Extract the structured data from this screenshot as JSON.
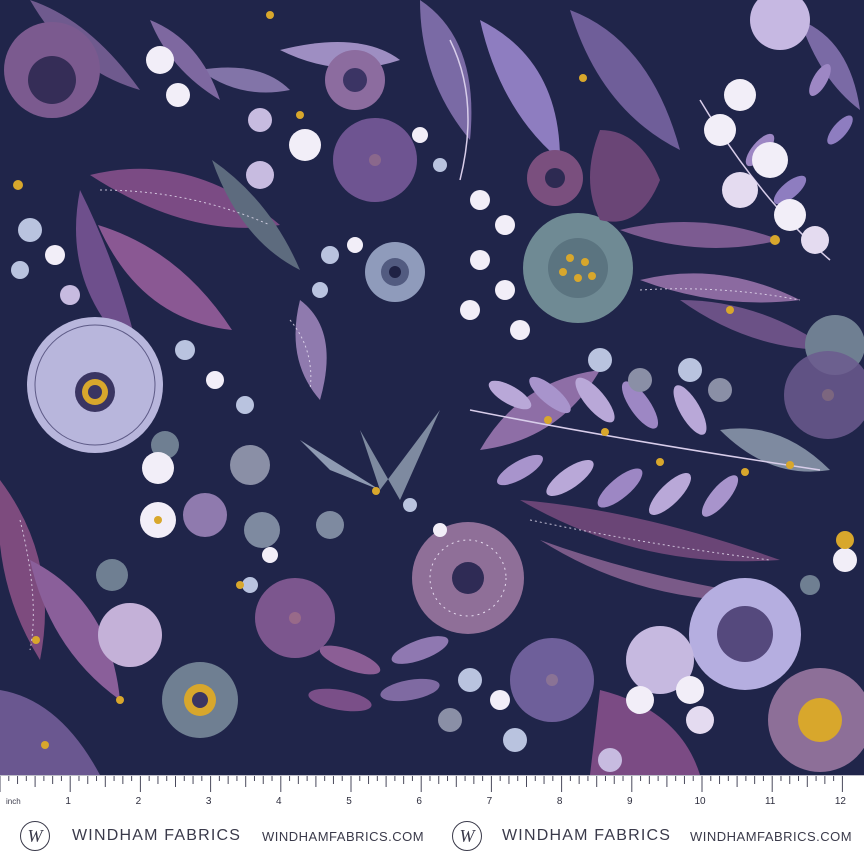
{
  "ruler": {
    "unit": "inch",
    "numbers": [
      "1",
      "2",
      "3",
      "4",
      "5",
      "6",
      "7",
      "8",
      "9",
      "10",
      "11",
      "12"
    ]
  },
  "footer": {
    "brand_left": "WINDHAM FABRICS",
    "url_left": "WINDHAMFABRICS.COM",
    "brand_right": "WINDHAM FABRICS",
    "url_right": "WINDHAMFABRICS.COM",
    "logo_letter": "W"
  },
  "colors": {
    "background": "#20254a",
    "lavender": "#b9a8d8",
    "purple": "#6e4f8c",
    "plum": "#7d4b7e",
    "slate": "#6f7f92",
    "mustard": "#d8a72c",
    "white": "#f2eef8"
  }
}
